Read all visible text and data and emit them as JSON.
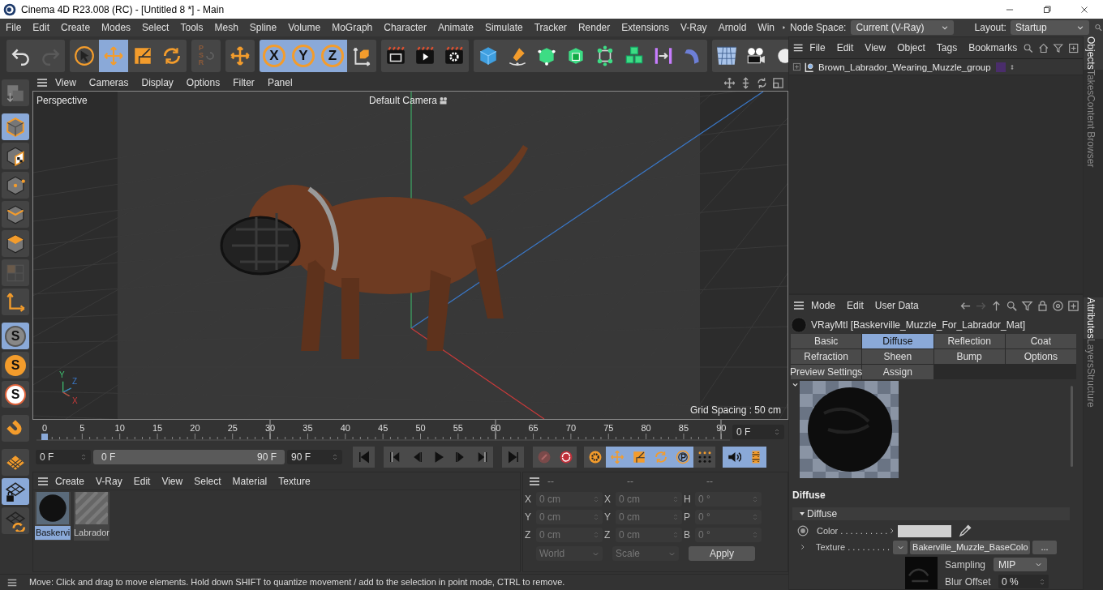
{
  "window": {
    "title": "Cinema 4D R23.008 (RC) - [Untitled 8 *] - Main"
  },
  "menu_bar": {
    "items": [
      "File",
      "Edit",
      "Create",
      "Modes",
      "Select",
      "Tools",
      "Mesh",
      "Spline",
      "Volume",
      "MoGraph",
      "Character",
      "Animate",
      "Simulate",
      "Tracker",
      "Render",
      "Extensions",
      "V-Ray",
      "Arnold",
      "Win"
    ],
    "node_space": {
      "label": "Node Space:",
      "value": "Current (V-Ray)"
    },
    "layout": {
      "label": "Layout:",
      "value": "Startup"
    }
  },
  "toolbar": {
    "groups": [
      [
        {
          "selected": false
        },
        {
          "selected": false
        }
      ],
      [
        {
          "selected": false
        },
        {
          "selected": true
        },
        {
          "selected": false
        },
        {
          "selected": false
        }
      ],
      [
        {
          "selected": false,
          "label": "PSR"
        }
      ],
      [
        {
          "selected": false
        }
      ],
      [
        {
          "selected": true,
          "label": "X"
        },
        {
          "selected": true,
          "label": "Y"
        },
        {
          "selected": true,
          "label": "Z"
        },
        {
          "selected": false
        }
      ],
      [
        {
          "selected": false
        },
        {
          "selected": false
        },
        {
          "selected": false
        }
      ],
      [
        {
          "selected": false
        },
        {
          "selected": false
        },
        {
          "selected": false
        },
        {
          "selected": false
        },
        {
          "selected": false
        },
        {
          "selected": false
        },
        {
          "selected": false
        },
        {
          "selected": false
        }
      ],
      [
        {
          "selected": false
        },
        {
          "selected": false
        },
        {
          "selected": false
        }
      ]
    ]
  },
  "left_toolbar": {
    "buttons": [
      {
        "selected": false
      },
      {
        "selected": true
      },
      {
        "selected": false
      },
      {
        "selected": false
      },
      {
        "selected": false
      },
      {
        "selected": false
      },
      {
        "selected": false
      },
      {
        "selected": false
      },
      {
        "selected": true,
        "label": "S"
      },
      {
        "selected": false,
        "label": "S"
      },
      {
        "selected": false,
        "label": "S"
      },
      {
        "selected": false
      },
      {
        "selected": false
      },
      {
        "selected": true
      },
      {
        "selected": false
      }
    ]
  },
  "viewport": {
    "menu": [
      "View",
      "Cameras",
      "Display",
      "Options",
      "Filter",
      "Panel"
    ],
    "view_name": "Perspective",
    "camera": "Default Camera",
    "grid_spacing": "Grid Spacing : 50 cm",
    "axis_labels": [
      "Y",
      "Z",
      "X"
    ]
  },
  "timeline": {
    "ticks": [
      "0",
      "5",
      "10",
      "15",
      "20",
      "25",
      "30",
      "35",
      "40",
      "45",
      "50",
      "55",
      "60",
      "65",
      "70",
      "75",
      "80",
      "85",
      "90"
    ],
    "current_frame": "0 F",
    "start": "0 F",
    "range_start": "0 F",
    "range_end": "90 F",
    "end": "90 F",
    "key_buttons": [
      {
        "selected": false
      },
      {
        "selected": false
      },
      {
        "selected": false
      },
      {
        "selected": true
      },
      {
        "selected": true
      },
      {
        "selected": true
      },
      {
        "selected": true
      },
      {
        "selected": false
      },
      {
        "selected": true
      },
      {
        "selected": true
      }
    ]
  },
  "materials": {
    "menu": [
      "Create",
      "V-Ray",
      "Edit",
      "View",
      "Select",
      "Material",
      "Texture"
    ],
    "items": [
      {
        "name": "Baskervi",
        "selected": true
      },
      {
        "name": "Labrador",
        "selected": false
      }
    ]
  },
  "coordinates": {
    "headers": [
      "--",
      "--",
      "--"
    ],
    "rows": [
      [
        "X",
        "0 cm",
        "X",
        "0 cm",
        "H",
        "0 °"
      ],
      [
        "Y",
        "0 cm",
        "Y",
        "0 cm",
        "P",
        "0 °"
      ],
      [
        "Z",
        "0 cm",
        "Z",
        "0 cm",
        "B",
        "0 °"
      ]
    ],
    "mode": "World",
    "size_mode": "Scale",
    "apply": "Apply"
  },
  "status_bar": "Move: Click and drag to move elements. Hold down SHIFT to quantize movement / add to the selection in point mode, CTRL to remove.",
  "objects": {
    "menu": [
      "File",
      "Edit",
      "View",
      "Object",
      "Tags",
      "Bookmarks"
    ],
    "items": [
      {
        "name": "Brown_Labrador_Wearing_Muzzle_group"
      }
    ]
  },
  "side_tabs_top": [
    {
      "label": "Objects",
      "selected": true
    },
    {
      "label": "Takes",
      "selected": false
    },
    {
      "label": "Content Browser",
      "selected": false
    }
  ],
  "attributes": {
    "menu": [
      "Mode",
      "Edit",
      "User Data"
    ],
    "title": "VRayMtl [Baskerville_Muzzle_For_Labrador_Mat]",
    "tabs": [
      {
        "label": "Basic",
        "selected": false
      },
      {
        "label": "Diffuse",
        "selected": true
      },
      {
        "label": "Reflection",
        "selected": false
      },
      {
        "label": "Coat",
        "selected": false
      },
      {
        "label": "Refraction",
        "selected": false
      },
      {
        "label": "Sheen",
        "selected": false
      },
      {
        "label": "Bump",
        "selected": false
      },
      {
        "label": "Options",
        "selected": false
      },
      {
        "label": "Preview Settings",
        "selected": false
      },
      {
        "label": "Assign",
        "selected": false
      }
    ],
    "section": "Diffuse",
    "group": {
      "label": "Diffuse",
      "expanded": true
    },
    "color": {
      "label": "Color . . . . . . . . . ."
    },
    "texture": {
      "label": "Texture . . . . . . . . .",
      "file": "Bakerville_Muzzle_BaseColo",
      "more": "..."
    },
    "sampling": {
      "label": "Sampling",
      "value": "MIP"
    },
    "blur_offset": {
      "label": "Blur Offset",
      "value": "0 %"
    }
  },
  "side_tabs_bottom": [
    {
      "label": "Attributes",
      "selected": true
    },
    {
      "label": "Layers",
      "selected": false
    },
    {
      "label": "Structure",
      "selected": false
    }
  ]
}
